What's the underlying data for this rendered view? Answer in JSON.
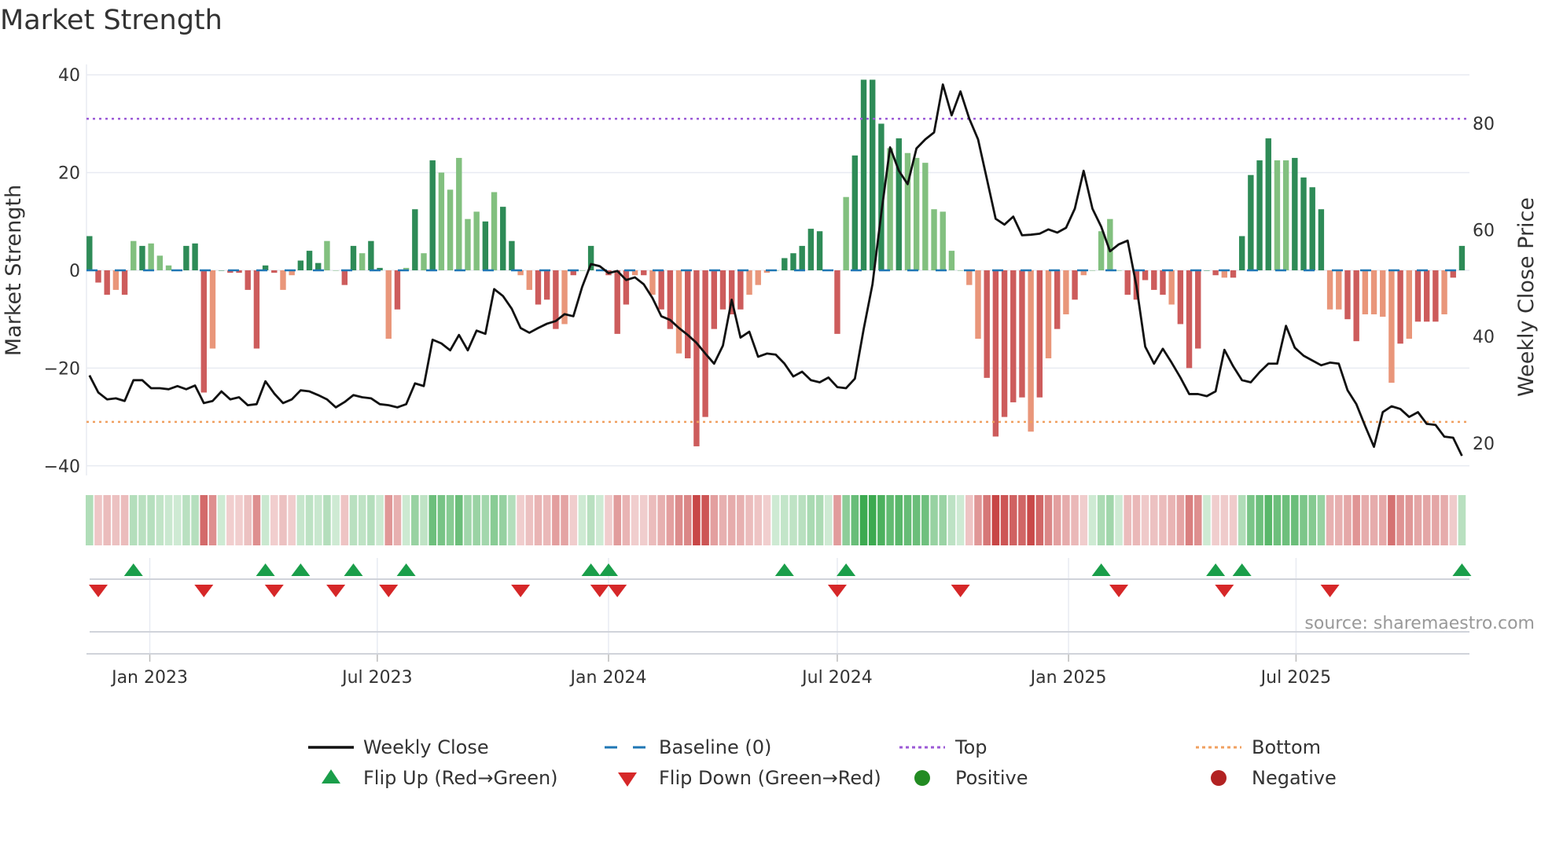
{
  "title": "Market Strength",
  "source": "source: sharemaestro.com",
  "chart_data": {
    "type": "bar",
    "title": "Market Strength",
    "ylabel": "Market Strength",
    "y2label": "Weekly Close Price",
    "ylim": [
      -42,
      40
    ],
    "y2lim": [
      15.5,
      92
    ],
    "yticks": [
      40,
      20,
      0,
      -20,
      -40
    ],
    "yticklabels": [
      "40",
      "20",
      "0",
      "−20",
      "−40"
    ],
    "y2ticks": [
      80,
      60,
      40,
      20
    ],
    "y2ticklabels": [
      "80",
      "60",
      "40",
      "20"
    ],
    "xticks": [
      {
        "label": "Jan 2023",
        "date": "2023-01-01"
      },
      {
        "label": "Jul 2023",
        "date": "2023-07-01"
      },
      {
        "label": "Jan 2024",
        "date": "2024-01-01"
      },
      {
        "label": "Jul 2024",
        "date": "2024-07-01"
      },
      {
        "label": "Jan 2025",
        "date": "2025-01-01"
      },
      {
        "label": "Jul 2025",
        "date": "2025-07-01"
      }
    ],
    "start_week": "2022-11-14",
    "top": 31,
    "bottom": -31,
    "strength": [
      7,
      -2.5,
      -5,
      -4,
      -5,
      6,
      5,
      5.5,
      3,
      1,
      0,
      5,
      5.5,
      -25,
      -16,
      0,
      -0.5,
      -0.5,
      -4,
      -16,
      1,
      -0.5,
      -4,
      -1,
      2,
      4,
      1.5,
      6,
      0,
      -3,
      5,
      3.5,
      6,
      0.5,
      -14,
      -8,
      0.5,
      12.5,
      3.5,
      22.5,
      20,
      16.5,
      23,
      10.5,
      12,
      10,
      16,
      13,
      6,
      -1,
      -4,
      -7,
      -6,
      -12,
      -11,
      -1,
      0,
      5,
      0,
      -1,
      -13,
      -7,
      -1,
      -1,
      -5,
      -8,
      -12,
      -17,
      -18,
      -36,
      -30,
      -12,
      -8,
      -9,
      -8,
      -5,
      -3,
      -0.5,
      0,
      2.5,
      3.5,
      5,
      8.5,
      8,
      0,
      -13,
      15,
      23.5,
      39,
      39,
      30,
      25,
      27,
      24,
      23,
      22,
      12.5,
      12,
      4,
      0,
      -3,
      -14,
      -22,
      -34,
      -30,
      -27,
      -26,
      -33,
      -26,
      -18,
      -12,
      -9,
      -6,
      -1,
      0,
      8,
      10.5,
      0,
      -5,
      -6,
      -2,
      -4,
      -5,
      -7,
      -11,
      -20,
      -16,
      0,
      -1,
      -1.5,
      -1.5,
      7,
      19.5,
      22.5,
      27,
      22.5,
      22.5,
      23,
      19,
      17,
      12.5,
      -8,
      -8,
      -10,
      -14.5,
      -9,
      -9,
      -9.5,
      -23,
      -15,
      -14,
      -10.5,
      -10.5,
      -10.5,
      -9,
      -1.5,
      5
    ],
    "shade": "dddldldlllddddldddddddlldddllddlddldldldllllldlddlldddldldddddldlddldddddddlllldddddddlddddldllllllllldddddldldldllllldddddldddddldddddllddddllddlllldldddldddllllddldd",
    "weekly_close": [
      32.7,
      29.5,
      28.2,
      28.4,
      27.9,
      31.8,
      31.8,
      30.3,
      30.3,
      30.1,
      30.7,
      30.1,
      30.8,
      27.5,
      27.9,
      29.7,
      28.2,
      28.6,
      27.1,
      27.3,
      31.6,
      29.3,
      27.5,
      28.2,
      29.9,
      29.7,
      29,
      28.2,
      26.7,
      27.7,
      29,
      28.6,
      28.4,
      27.3,
      27.1,
      26.7,
      27.3,
      31.2,
      30.7,
      39.4,
      38.7,
      37.4,
      40.3,
      37.4,
      41.1,
      40.5,
      48.9,
      47.6,
      45.2,
      41.6,
      40.7,
      41.6,
      42.4,
      42.9,
      44.2,
      43.8,
      49.3,
      53.6,
      53.2,
      51.9,
      52.3,
      50.6,
      51.1,
      49.8,
      47.2,
      43.8,
      43.1,
      41.6,
      40.3,
      38.8,
      36.8,
      34.9,
      38.3,
      46.9,
      39.8,
      40.9,
      36.2,
      36.8,
      36.6,
      34.9,
      32.5,
      33.4,
      31.8,
      31.4,
      32.3,
      30.5,
      30.3,
      32.1,
      41.4,
      49.8,
      63.1,
      75.5,
      71.1,
      68.6,
      75.3,
      77,
      78.3,
      87.3,
      81.5,
      86,
      80.9,
      77,
      69.6,
      62.1,
      61,
      62.5,
      59,
      59.1,
      59.3,
      60.1,
      59.5,
      60.4,
      64,
      71.1,
      64,
      60.6,
      56,
      57.3,
      58,
      49.5,
      38.1,
      34.9,
      37.7,
      35.1,
      32.3,
      29.2,
      29.2,
      28.8,
      29.7,
      37.5,
      34.4,
      31.8,
      31.4,
      33.3,
      34.9,
      34.9,
      42,
      37.9,
      36.4,
      35.5,
      34.6,
      35.1,
      34.9,
      29.9,
      27.3,
      23.2,
      19.3,
      25.8,
      26.9,
      26.4,
      24.9,
      25.8,
      23.6,
      23.4,
      21.2,
      21,
      17.6
    ],
    "flip_up_weeks": [
      5,
      20,
      24,
      30,
      36,
      57,
      59,
      79,
      86,
      115,
      128,
      131,
      156
    ],
    "flip_down_weeks": [
      1,
      13,
      21,
      28,
      34,
      49,
      58,
      60,
      85,
      99,
      117,
      129,
      141
    ],
    "legend": {
      "placement": "bottom",
      "items": [
        {
          "key": "close",
          "label": "Weekly Close"
        },
        {
          "key": "baseline",
          "label": "Baseline (0)"
        },
        {
          "key": "top",
          "label": "Top"
        },
        {
          "key": "bottom",
          "label": "Bottom"
        },
        {
          "key": "up",
          "label": "Flip Up (Red→Green)"
        },
        {
          "key": "down",
          "label": "Flip Down (Green→Red)"
        },
        {
          "key": "pos",
          "label": "Positive"
        },
        {
          "key": "neg",
          "label": "Negative"
        }
      ]
    },
    "colors": {
      "pos_dark": "#2e8b57",
      "pos_light": "#82c07f",
      "neg_dark": "#cd5c5c",
      "neg_light": "#e9967a",
      "close": "#111111",
      "baseline": "#1f77b4",
      "top": "#9b59d6",
      "bottom": "#f0a060",
      "up": "#1a9e4a",
      "down": "#d62728",
      "pos_dot": "#228b22",
      "neg_dot": "#b22222"
    }
  }
}
